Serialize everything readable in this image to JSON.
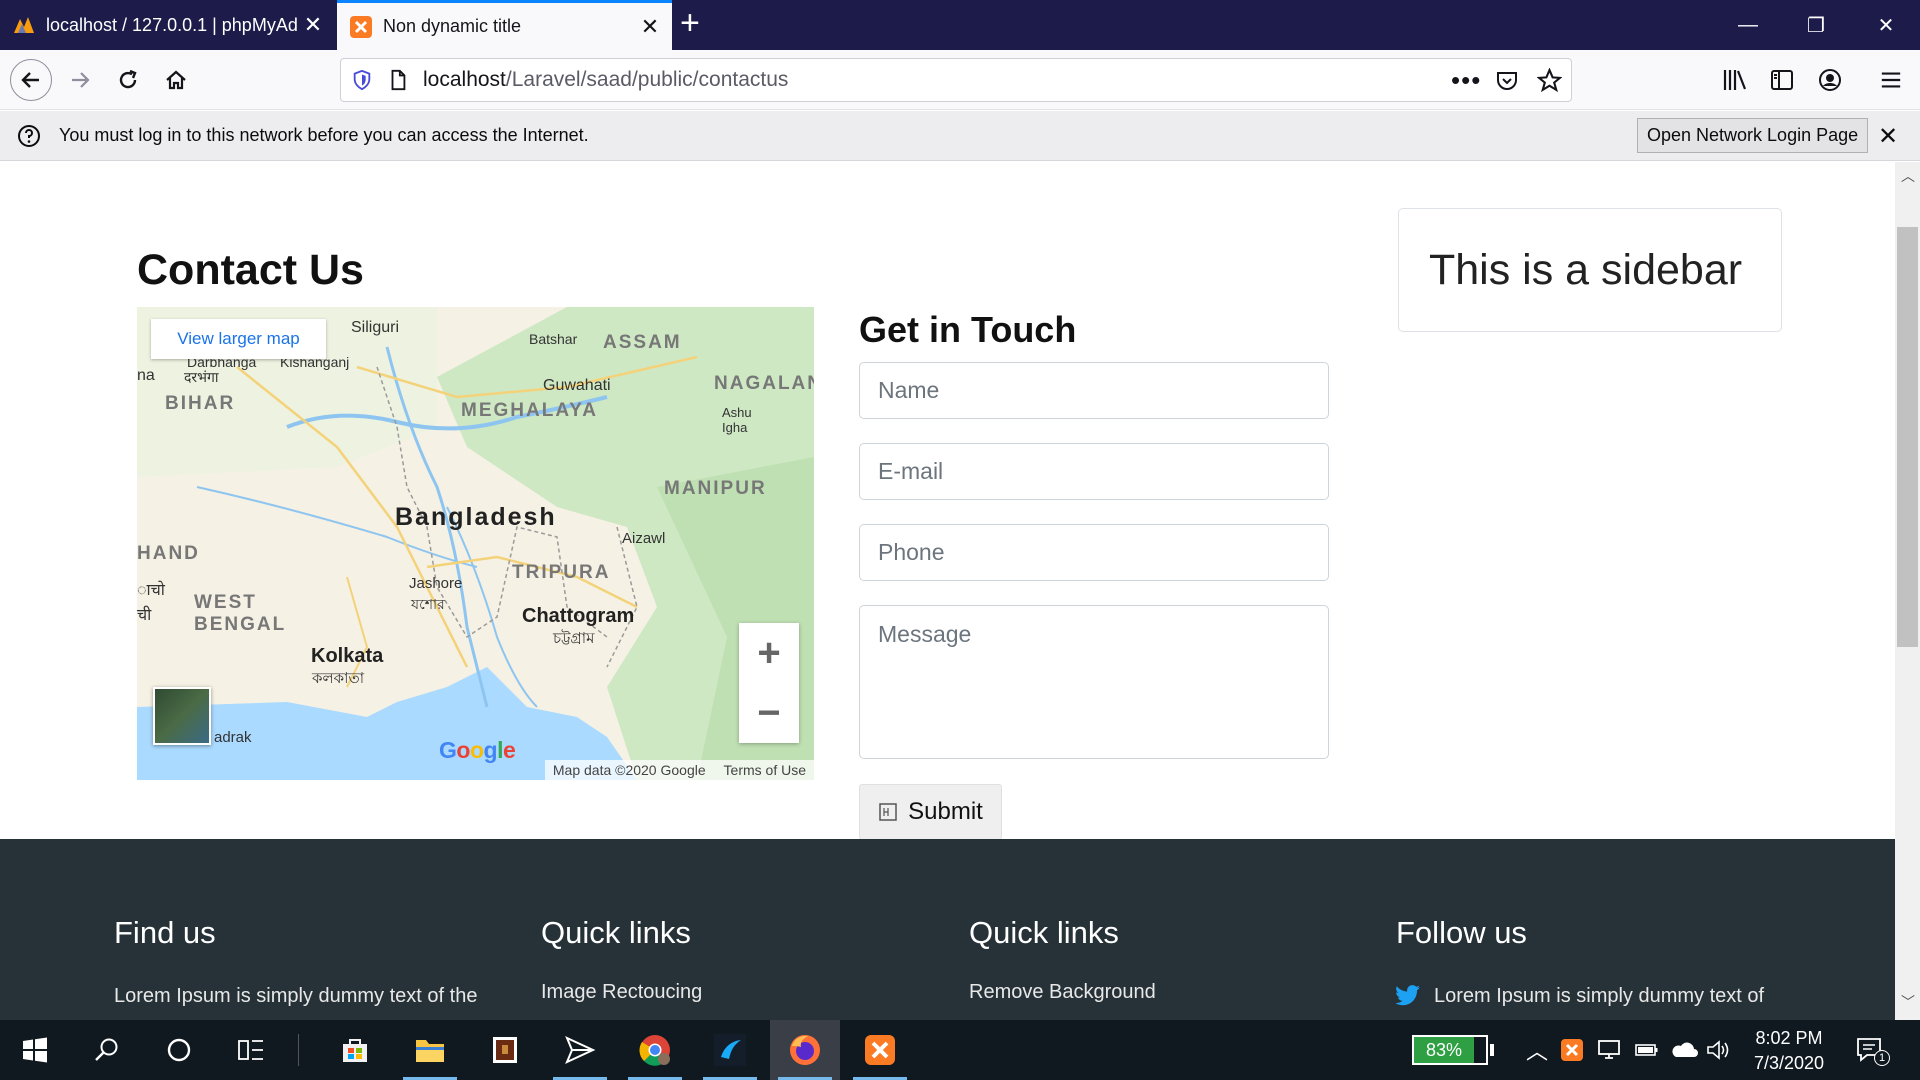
{
  "browser": {
    "tabs": [
      {
        "title": "localhost / 127.0.0.1 | phpMyAd",
        "active": false
      },
      {
        "title": "Non dynamic title",
        "active": true
      }
    ],
    "url_host": "localhost",
    "url_path": "/Laravel/saad/public/contactus"
  },
  "notification": {
    "message": "You must log in to this network before you can access the Internet.",
    "button": "Open Network Login Page"
  },
  "page": {
    "title": "Contact Us",
    "map": {
      "view_larger": "View larger map",
      "attribution": "Map data ©2020 Google",
      "terms": "Terms of Use",
      "labels": [
        "Siliguri",
        "Batshar",
        "ASSAM",
        "Guwahati",
        "NAGALAN",
        "Ashu Igha",
        "Darbhanga",
        "Kishanganj",
        "दरभंगा",
        "BIHAR",
        "MEGHALAYA",
        "MANIPUR",
        "Bangladesh",
        "Aizawl",
        "HAND",
        "TRIPURA",
        "Jashore",
        "যশোর",
        "WEST BENGAL",
        "Chattogram",
        "চট্টগ্রাম",
        "Kolkata",
        "কলকাতা",
        "adrak",
        "na",
        "ाचो",
        "ची"
      ]
    },
    "form": {
      "title": "Get in Touch",
      "name_placeholder": "Name",
      "email_placeholder": "E-mail",
      "phone_placeholder": "Phone",
      "message_placeholder": "Message",
      "submit_label": "Submit"
    },
    "sidebar_text": "This is a sidebar"
  },
  "footer": {
    "columns": [
      {
        "heading": "Find us",
        "text": "Lorem Ipsum is simply dummy text of the"
      },
      {
        "heading": "Quick links",
        "text": "Image Rectoucing"
      },
      {
        "heading": "Quick links",
        "text": "Remove Background"
      },
      {
        "heading": "Follow us",
        "text": "Lorem Ipsum is simply dummy text of"
      }
    ]
  },
  "taskbar": {
    "battery": "83%",
    "time": "8:02 PM",
    "date": "7/3/2020",
    "notification_count": "1"
  },
  "colors": {
    "tab_strip": "#1c1b4a",
    "footer_bg": "#263238",
    "link_blue": "#1a73e8",
    "battery_green": "#2ea043"
  }
}
